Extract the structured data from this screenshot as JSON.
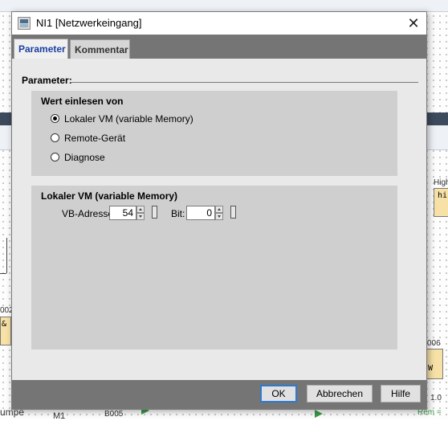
{
  "dialog": {
    "title": "NI1 [Netzwerkeingang]",
    "close_symbol": "✕",
    "icon": "network-input-app-icon"
  },
  "tabs": [
    {
      "label": "Parameter",
      "selected": true
    },
    {
      "label": "Kommentar",
      "selected": false
    }
  ],
  "parameter_section": {
    "label": "Parameter:"
  },
  "read_group": {
    "title": "Wert einlesen von",
    "options": [
      {
        "label": "Lokaler VM (variable Memory)",
        "checked": true
      },
      {
        "label": "Remote-Gerät",
        "checked": false
      },
      {
        "label": "Diagnose",
        "checked": false
      }
    ]
  },
  "vm_group": {
    "title": "Lokaler VM (variable Memory)",
    "vb_label": "VB-Adresse:",
    "vb_value": "54",
    "bit_label": "Bit:",
    "bit_value": "0"
  },
  "buttons": {
    "ok": "OK",
    "cancel": "Abbrechen",
    "help": "Hilfe"
  },
  "background": {
    "labels": [
      "High",
      "hi",
      "002",
      "&",
      "006",
      "umpe",
      "M1",
      "B005",
      "Rem = ",
      "W",
      "1.0"
    ]
  },
  "colors": {
    "accent": "#2d7bd1",
    "tab_active_text": "#1b3fa0",
    "chrome_gray": "#757575",
    "group_gray": "#cfcfcf"
  }
}
